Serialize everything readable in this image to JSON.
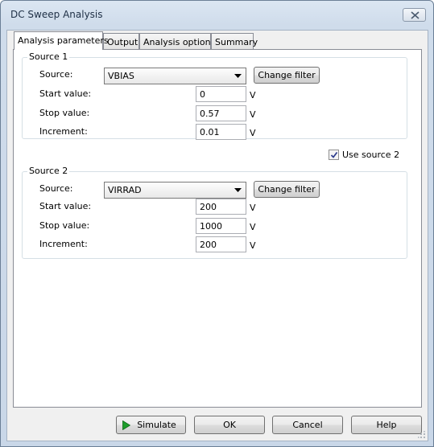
{
  "window": {
    "title": "DC Sweep Analysis"
  },
  "tabs": [
    {
      "label": "Analysis parameters",
      "active": true
    },
    {
      "label": "Output",
      "active": false
    },
    {
      "label": "Analysis options",
      "active": false
    },
    {
      "label": "Summary",
      "active": false
    }
  ],
  "source1": {
    "group_label": "Source 1",
    "source_label": "Source:",
    "source_value": "VBIAS",
    "change_filter_label": "Change filter",
    "start_label": "Start value:",
    "start_value": "0",
    "start_unit": "V",
    "stop_label": "Stop value:",
    "stop_value": "0.57",
    "stop_unit": "V",
    "increment_label": "Increment:",
    "increment_value": "0.01",
    "increment_unit": "V"
  },
  "use_source2": {
    "label": "Use source 2",
    "checked": true
  },
  "source2": {
    "group_label": "Source 2",
    "source_label": "Source:",
    "source_value": "VIRRAD",
    "change_filter_label": "Change filter",
    "start_label": "Start value:",
    "start_value": "200",
    "start_unit": "V",
    "stop_label": "Stop value:",
    "stop_value": "1000",
    "stop_unit": "V",
    "increment_label": "Increment:",
    "increment_value": "200",
    "increment_unit": "V"
  },
  "footer": {
    "simulate_label": "Simulate",
    "ok_label": "OK",
    "cancel_label": "Cancel",
    "help_label": "Help"
  },
  "icons": {
    "close": "close-icon",
    "dropdown": "chevron-down-icon",
    "simulate": "play-icon",
    "checkbox": "checkmark-icon",
    "resize": "resize-grip-icon"
  },
  "colors": {
    "play_green": "#1c9d2a"
  }
}
